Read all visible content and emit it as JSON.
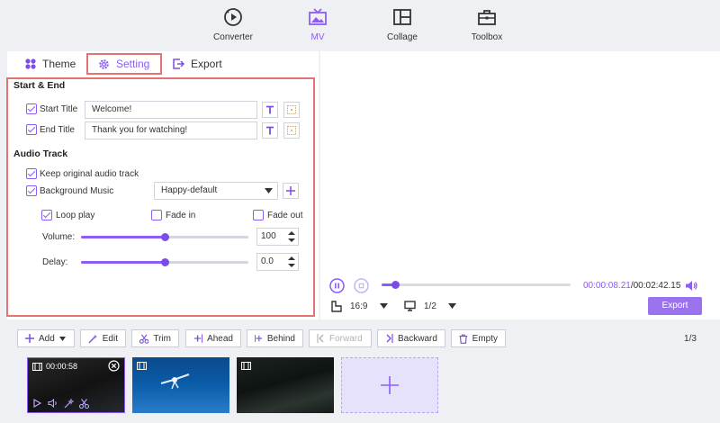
{
  "nav": [
    {
      "label": "Converter",
      "icon": "converter-icon"
    },
    {
      "label": "MV",
      "icon": "mv-icon",
      "active": true
    },
    {
      "label": "Collage",
      "icon": "collage-icon"
    },
    {
      "label": "Toolbox",
      "icon": "toolbox-icon"
    }
  ],
  "tabs": {
    "theme": "Theme",
    "setting": "Setting",
    "export": "Export"
  },
  "start_end": {
    "title": "Start & End",
    "start_label": "Start Title",
    "start_value": "Welcome!",
    "end_label": "End Title",
    "end_value": "Thank you for watching!"
  },
  "audio": {
    "title": "Audio Track",
    "keep_original": "Keep original audio track",
    "background_music": "Background Music",
    "music_selected": "Happy-default",
    "loop_play": "Loop play",
    "fade_in": "Fade in",
    "fade_out": "Fade out",
    "volume_label": "Volume:",
    "volume_value": "100",
    "volume_level": 0.5,
    "delay_label": "Delay:",
    "delay_value": "0.0",
    "delay_level": 0.5
  },
  "player": {
    "current_time": "00:00:08.21",
    "total_time": "/00:02:42.15",
    "progress": 0.07,
    "aspect": "16:9",
    "screen": "1/2",
    "export_label": "Export"
  },
  "toolbar": {
    "add": "Add",
    "edit": "Edit",
    "trim": "Trim",
    "ahead": "Ahead",
    "behind": "Behind",
    "forward": "Forward",
    "backward": "Backward",
    "empty": "Empty",
    "page_current": "1",
    "page_total": "/3"
  },
  "clips": [
    {
      "duration": "00:00:58"
    }
  ],
  "colors": {
    "accent": "#8b5cf6",
    "highlight": "#e57373"
  }
}
